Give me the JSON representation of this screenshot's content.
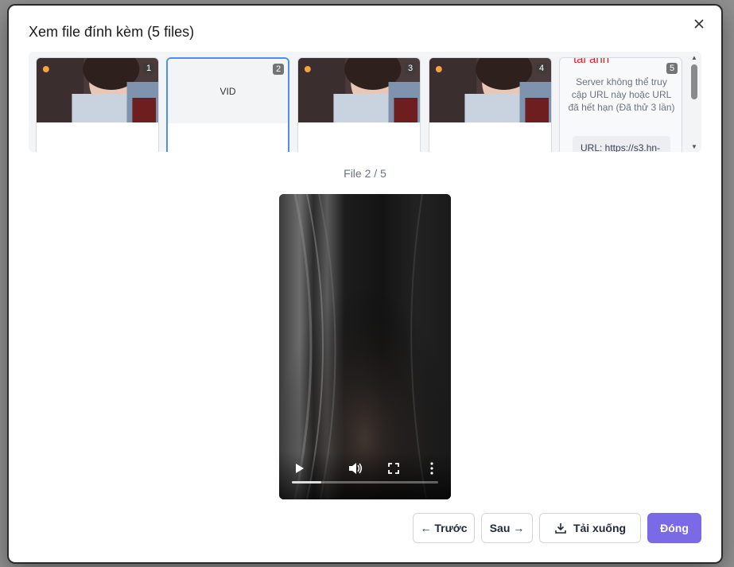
{
  "modal": {
    "title": "Xem file đính kèm (5 files)",
    "close_label": "×"
  },
  "thumbnails": [
    {
      "number": "1",
      "kind": "image"
    },
    {
      "number": "2",
      "kind": "video",
      "label": "VID",
      "active": true
    },
    {
      "number": "3",
      "kind": "image"
    },
    {
      "number": "4",
      "kind": "image"
    },
    {
      "number": "5",
      "kind": "error",
      "error_title": "tải ảnh",
      "error_message": "Server không thể truy cập URL này hoặc URL đã hết hạn (Đã thử 3 lần)",
      "url_text": "URL: https://s3.hn-"
    }
  ],
  "counter": "File 2 / 5",
  "video": {
    "progress": 0.2
  },
  "buttons": {
    "prev": "← Trước",
    "next": "Sau →",
    "download": "Tải xuống",
    "close": "Đóng"
  },
  "colors": {
    "accent": "#7a6ae6",
    "active_border": "#4d8ef5",
    "error": "#e11d1d"
  }
}
